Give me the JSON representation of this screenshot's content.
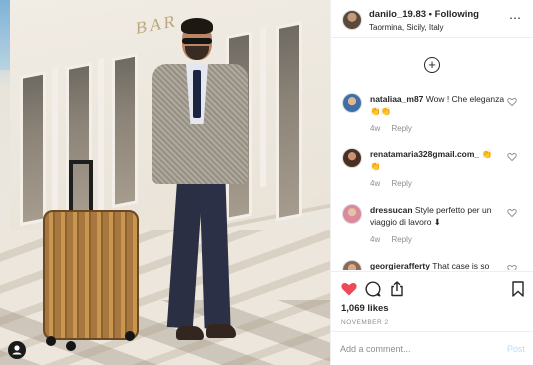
{
  "photo": {
    "sign_text": "BAR",
    "tag_icon": "person-icon"
  },
  "post_header": {
    "username": "danilo_19.83",
    "separator": "•",
    "follow_label": "Following",
    "location": "Taormina, Sicily, Italy",
    "more_icon": "⋯"
  },
  "load_more_icon": "+",
  "comments": [
    {
      "username": "nataliaa_m87",
      "text": "Wow ! Che eleganza 👏👏",
      "age": "4w",
      "reply_label": "Reply"
    },
    {
      "username": "renatamaria328gmail.com_",
      "text": "👏 👏",
      "age": "4w",
      "reply_label": "Reply"
    },
    {
      "username": "dressucan",
      "text": "Style perfetto per un viaggio di lavoro ⬇",
      "age": "4w",
      "reply_label": "Reply"
    },
    {
      "username": "georgierafferty",
      "text": "That case is so",
      "age": "",
      "reply_label": ""
    }
  ],
  "actions": {
    "like_icon": "♥",
    "comment_icon": "◯",
    "share_icon": "⇧",
    "save_icon": "⚑",
    "like_color": "#ed4956"
  },
  "likes": "1,069 likes",
  "date": "NOVEMBER 2",
  "add_comment": {
    "placeholder": "Add a comment...",
    "post_label": "Post"
  }
}
